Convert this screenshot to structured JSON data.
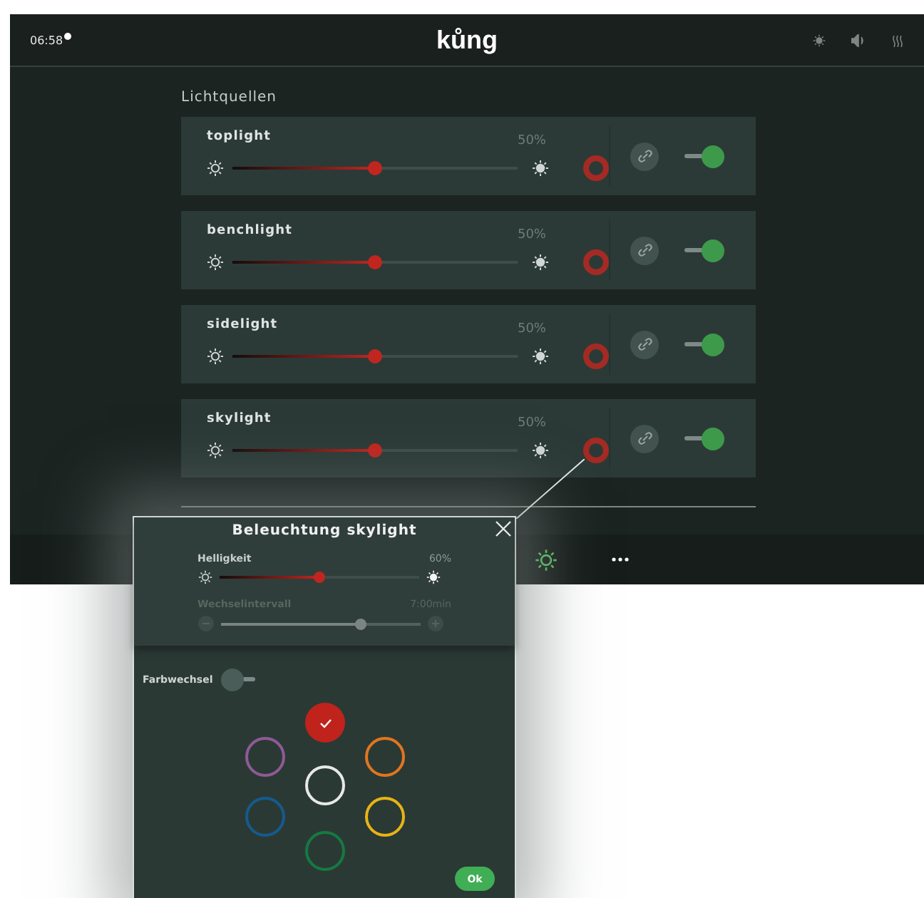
{
  "header": {
    "time": "06:58",
    "logo": "kůng"
  },
  "section_title": "Lichtquellen",
  "lights": [
    {
      "name": "toplight",
      "reading": "50%",
      "level": 0.5,
      "on": true
    },
    {
      "name": "benchlight",
      "reading": "50%",
      "level": 0.5,
      "on": true
    },
    {
      "name": "sidelight",
      "reading": "50%",
      "level": 0.5,
      "on": true
    },
    {
      "name": "skylight",
      "reading": "50%",
      "level": 0.5,
      "on": true
    }
  ],
  "popup": {
    "title": "Beleuchtung skylight",
    "sliders": [
      {
        "label": "Helligkeit",
        "reading": "60%",
        "level": 0.5,
        "disabled": false
      },
      {
        "label": "Wechselintervall",
        "reading": "7:00min",
        "level": 0.7,
        "disabled": true
      }
    ],
    "color_cycle": {
      "label": "Farbwechsel",
      "on": false
    },
    "colors": [
      {
        "color": "#c0231b",
        "selected": true
      },
      {
        "color": "#8e5a96",
        "selected": false
      },
      {
        "color": "#e0761f",
        "selected": false
      },
      {
        "color": "#e8e8e8",
        "selected": false
      },
      {
        "color": "#155a8e",
        "selected": false
      },
      {
        "color": "#e8b414",
        "selected": false
      },
      {
        "color": "#147a42",
        "selected": false
      }
    ],
    "ok": "Ok"
  }
}
